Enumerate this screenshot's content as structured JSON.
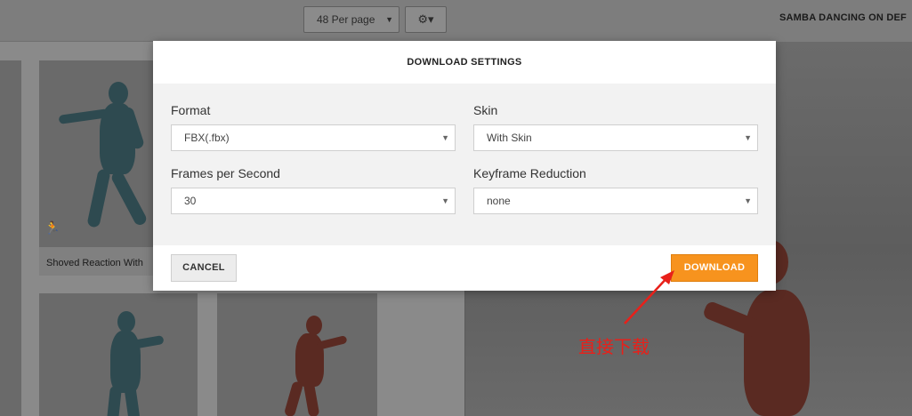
{
  "toolbar": {
    "per_page_label": "48 Per page",
    "per_page_caret": "▼",
    "gear_icon": "⚙▾"
  },
  "preview": {
    "title": "SAMBA DANCING ON DEF"
  },
  "grid": {
    "tile_caption": "Shoved Reaction With"
  },
  "modal": {
    "title": "DOWNLOAD SETTINGS",
    "format_label": "Format",
    "format_value": "FBX(.fbx)",
    "skin_label": "Skin",
    "skin_value": "With Skin",
    "fps_label": "Frames per Second",
    "fps_value": "30",
    "keyframe_label": "Keyframe Reduction",
    "keyframe_value": "none",
    "select_caret": "▼",
    "cancel_label": "CANCEL",
    "download_label": "DOWNLOAD",
    "accent_color": "#f7931e"
  },
  "annotation": {
    "text": "直接下载",
    "color": "#e8201a"
  }
}
